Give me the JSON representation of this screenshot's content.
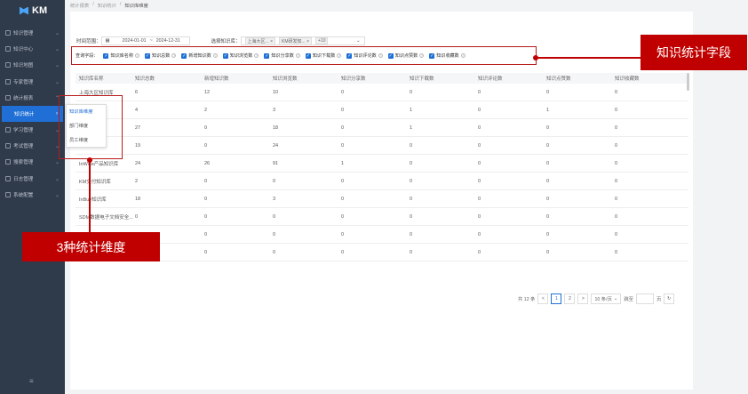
{
  "app": {
    "logo_text": "KM"
  },
  "sidebar": {
    "items": [
      {
        "label": "知识管理"
      },
      {
        "label": "知识中心"
      },
      {
        "label": "知识地图"
      },
      {
        "label": "专家管理"
      },
      {
        "label": "统计报表"
      },
      {
        "label": "知识统计",
        "active": true
      },
      {
        "label": "学习管理"
      },
      {
        "label": "考试管理"
      },
      {
        "label": "搜索管理"
      },
      {
        "label": "日志管理"
      },
      {
        "label": "系统配置"
      }
    ],
    "collapse_icon": "menu-fold-icon"
  },
  "breadcrumb": {
    "items": [
      "统计报表",
      "知识统计",
      "知识库维度"
    ]
  },
  "filters": {
    "time_label": "时间范围：",
    "date_start": "2024-01-01",
    "date_sep": "~",
    "date_end": "2024-12-31",
    "kb_label": "选择知识库：",
    "kb_tags": [
      "上海大区...",
      "KM研发知...",
      "+10"
    ],
    "fields_label": "查询字段：",
    "fields": [
      "知识库名称",
      "知识总数",
      "新增知识数",
      "知识浏览数",
      "知识分享数",
      "知识下载数",
      "知识评论数",
      "知识点赞数",
      "知识收藏数"
    ]
  },
  "table": {
    "headers": [
      "知识库名称",
      "知识总数",
      "新增知识数",
      "知识浏览数",
      "知识分享数",
      "知识下载数",
      "知识评论数",
      "知识点赞数",
      "知识收藏数"
    ],
    "rows": [
      [
        "上海大区知识库",
        "6",
        "12",
        "10",
        "0",
        "0",
        "0",
        "0",
        "0"
      ],
      [
        "",
        "4",
        "2",
        "3",
        "0",
        "1",
        "0",
        "1",
        "0"
      ],
      [
        "",
        "27",
        "0",
        "18",
        "0",
        "1",
        "0",
        "0",
        "0"
      ],
      [
        "",
        "19",
        "0",
        "24",
        "0",
        "0",
        "0",
        "0",
        "0"
      ],
      [
        "InWise产品知识库",
        "24",
        "26",
        "91",
        "1",
        "0",
        "0",
        "0",
        "0"
      ],
      [
        "KM交付知识库",
        "2",
        "0",
        "0",
        "0",
        "0",
        "0",
        "0",
        "0"
      ],
      [
        "InBuy知识库",
        "18",
        "0",
        "3",
        "0",
        "0",
        "0",
        "0",
        "0"
      ],
      [
        "SDM数据电子文档安全...",
        "0",
        "0",
        "0",
        "0",
        "0",
        "0",
        "0",
        "0"
      ],
      [
        "",
        "",
        "0",
        "0",
        "0",
        "0",
        "0",
        "0",
        "0"
      ],
      [
        "",
        "",
        "0",
        "0",
        "0",
        "0",
        "0",
        "0",
        "0"
      ]
    ]
  },
  "submenu": {
    "items": [
      "知识库维度",
      "部门维度",
      "员工维度"
    ]
  },
  "pager": {
    "total": "共 12 条",
    "prev": "<",
    "pages": [
      "1",
      "2"
    ],
    "next": ">",
    "size": "10 条/页",
    "goto": "跳至",
    "page_unit": "页"
  },
  "callouts": {
    "fields": "知识统计字段",
    "dims": "3种统计维度"
  },
  "colors": {
    "accent": "#1f6fd6",
    "callout": "#c00000",
    "sidebar": "#2f3a4a"
  }
}
